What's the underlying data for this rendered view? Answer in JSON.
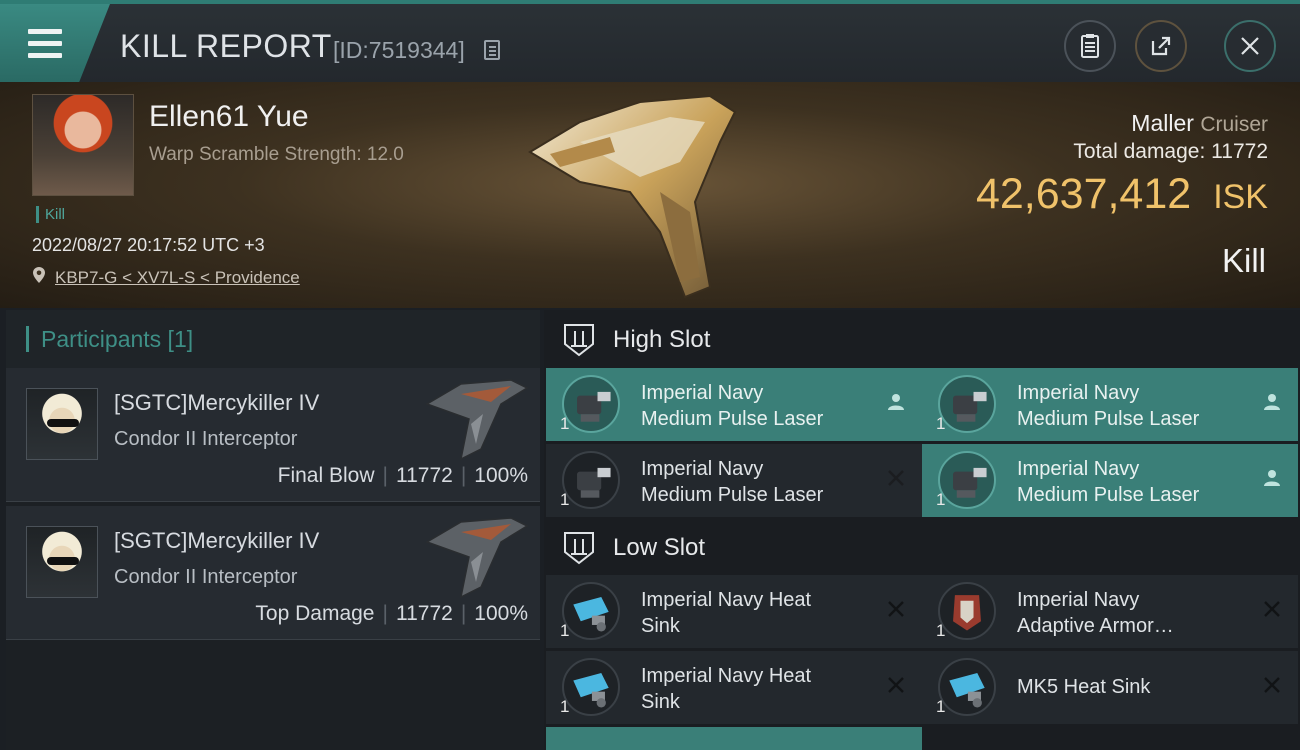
{
  "header": {
    "title": "KILL REPORT",
    "kill_id": "[ID:7519344]"
  },
  "victim": {
    "name": "Ellen61 Yue",
    "warp_scramble": "Warp Scramble Strength: 12.0",
    "kill_tag": "Kill",
    "datetime": "2022/08/27 20:17:52 UTC +3",
    "location": "KBP7-G < XV7L-S < Providence",
    "ship_name": "Maller",
    "ship_class": "Cruiser",
    "total_damage_label": "Total damage:",
    "total_damage_value": "11772",
    "isk_value": "42,637,412",
    "isk_unit": "ISK",
    "result": "Kill"
  },
  "participants": {
    "title": "Participants [1]",
    "rows": [
      {
        "name": "[SGTC]Mercykiller IV",
        "ship": "Condor II Interceptor",
        "role": "Final Blow",
        "damage": "11772",
        "percent": "100%"
      },
      {
        "name": "[SGTC]Mercykiller IV",
        "ship": "Condor II Interceptor",
        "role": "Top Damage",
        "damage": "11772",
        "percent": "100%"
      }
    ]
  },
  "slots": {
    "high": {
      "title": "High Slot",
      "modules": [
        {
          "line1": "Imperial Navy",
          "line2": "Medium Pulse Laser",
          "qty": "1",
          "status": "person-icon"
        },
        {
          "line1": "Imperial Navy",
          "line2": "Medium Pulse Laser",
          "qty": "1",
          "status": "person-icon"
        },
        {
          "line1": "Imperial Navy",
          "line2": "Medium Pulse Laser",
          "qty": "1",
          "status": "x-icon"
        },
        {
          "line1": "Imperial Navy",
          "line2": "Medium Pulse Laser",
          "qty": "1",
          "status": "person-icon"
        }
      ]
    },
    "low": {
      "title": "Low Slot",
      "modules": [
        {
          "line1": "Imperial Navy Heat",
          "line2": "Sink",
          "qty": "1",
          "status": "x-icon"
        },
        {
          "line1": "Imperial Navy",
          "line2": "Adaptive Armor…",
          "qty": "1",
          "status": "x-icon"
        },
        {
          "line1": "Imperial Navy Heat",
          "line2": "Sink",
          "qty": "1",
          "status": "x-icon"
        },
        {
          "line1": "MK5 Heat Sink",
          "line2": "",
          "qty": "1",
          "status": "x-icon"
        }
      ]
    }
  },
  "colors": {
    "accent": "#3e8f86",
    "isk": "#f0c26a",
    "active_module": "#3a7f78"
  }
}
